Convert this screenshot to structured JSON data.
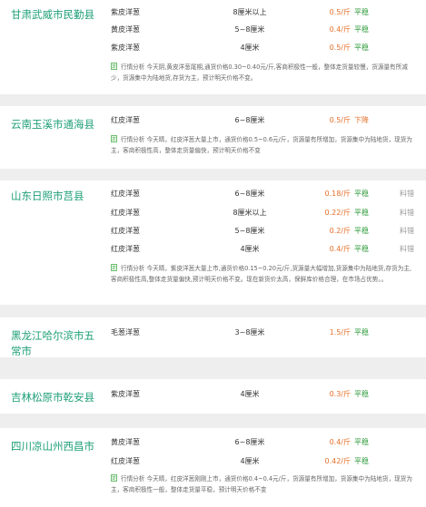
{
  "colors": {
    "location": "#1e9f77",
    "price": "#e5702a",
    "trend_flat": "#2d9a3a",
    "trend_down": "#e5702a",
    "background": "#eeeeee",
    "card": "#ffffff"
  },
  "icons": {
    "note": "note-icon"
  },
  "blocks": [
    {
      "location": "甘肃武威市民勤县",
      "rows": [
        {
          "variety": "紫皮洋葱",
          "size": "8厘米以上",
          "price": "0.5/斤",
          "trend": "平稳",
          "extra": ""
        },
        {
          "variety": "黄皮洋葱",
          "size": "5~8厘米",
          "price": "0.4/斤",
          "trend": "平稳",
          "extra": ""
        },
        {
          "variety": "紫皮洋葱",
          "size": "4厘米",
          "price": "0.5/斤",
          "trend": "平稳",
          "extra": ""
        }
      ],
      "note": "行情分析 今天阴,黄皮洋葱尾期,通货价格0.30~0.40元/斤,客商积极性一般，整体走货量较慢，货源量有所减少，货源集中为陆地货,存货为主，预计明天价格不变。"
    },
    {
      "location": "云南玉溪市通海县",
      "rows": [
        {
          "variety": "红皮洋葱",
          "size": "6~8厘米",
          "price": "0.5/斤",
          "trend": "下降",
          "extra": ""
        }
      ],
      "note": "行情分析 今天晴，红皮洋葱大量上市，通货价格0.5~0.6元/斤，货源量有所增加，货源集中为陆地货，现货为主，客商积极性高，整体走货量偏快，预计明天价格不变"
    },
    {
      "location": "山东日照市莒县",
      "rows": [
        {
          "variety": "红皮洋葱",
          "size": "6~8厘米",
          "price": "0.18/斤",
          "trend": "平稳",
          "extra": "料错"
        },
        {
          "variety": "红皮洋葱",
          "size": "8厘米以上",
          "price": "0.22/斤",
          "trend": "平稳",
          "extra": "料错"
        },
        {
          "variety": "红皮洋葱",
          "size": "5~8厘米",
          "price": "0.2/斤",
          "trend": "平稳",
          "extra": "料错"
        },
        {
          "variety": "红皮洋葱",
          "size": "4厘米",
          "price": "0.4/斤",
          "trend": "平稳",
          "extra": "料错"
        }
      ],
      "note": "行情分析 今天晴，紫皮洋葱大量上市,通货价格0.15~0.20元/斤,货源量大幅增加,货源集中为陆地货,存货为主,客商积极性高,整体走货量偏快,预计明天价格不变。现在新货价太高，保鲜库价格合理，在市场占优势。。"
    },
    {
      "location": "黑龙江哈尔滨市五常市",
      "rows": [
        {
          "variety": "毛葱洋葱",
          "size": "3~8厘米",
          "price": "1.5/斤",
          "trend": "平稳",
          "extra": ""
        }
      ],
      "note": ""
    },
    {
      "location": "吉林松原市乾安县",
      "rows": [
        {
          "variety": "紫皮洋葱",
          "size": "4厘米",
          "price": "0.3/斤",
          "trend": "平稳",
          "extra": ""
        }
      ],
      "note": ""
    },
    {
      "location": "四川凉山州西昌市",
      "rows": [
        {
          "variety": "黄皮洋葱",
          "size": "6~8厘米",
          "price": "0.4/斤",
          "trend": "平稳",
          "extra": ""
        },
        {
          "variety": "红皮洋葱",
          "size": "4厘米",
          "price": "0.42/斤",
          "trend": "平稳",
          "extra": ""
        }
      ],
      "note": "行情分析 今天晴，红皮洋葱刚刚上市，通货价格0.4~0.4元/斤，货源量有所增加，货源集中为陆地货，现货为主，客商积极性一般，整体走货量平稳，预计明天价格不变"
    }
  ]
}
